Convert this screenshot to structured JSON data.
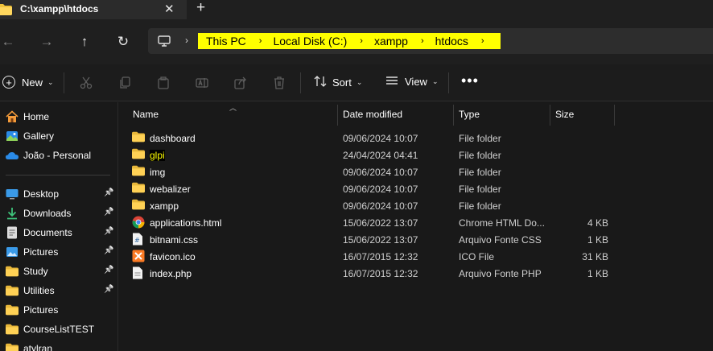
{
  "tab": {
    "title": "C:\\xampp\\htdocs",
    "close": "✕",
    "new_tab": "+"
  },
  "nav": {
    "back": "←",
    "forward": "→",
    "up": "↑",
    "refresh": "↻"
  },
  "address": {
    "crumbs": [
      "This PC",
      "Local Disk (C:)",
      "xampp",
      "htdocs"
    ],
    "highlight_color": "#ffff00"
  },
  "commands": {
    "new": "New",
    "sort": "Sort",
    "view": "View",
    "more": "•••"
  },
  "sidebar": {
    "quick": [
      {
        "label": "Home",
        "icon": "home-icon"
      },
      {
        "label": "Gallery",
        "icon": "gallery-icon"
      },
      {
        "label": "João - Personal",
        "icon": "onedrive-icon"
      }
    ],
    "pinned": [
      {
        "label": "Desktop",
        "icon": "desktop-icon",
        "pinned": true
      },
      {
        "label": "Downloads",
        "icon": "downloads-icon",
        "pinned": true
      },
      {
        "label": "Documents",
        "icon": "documents-icon",
        "pinned": true
      },
      {
        "label": "Pictures",
        "icon": "pictures-icon",
        "pinned": true
      },
      {
        "label": "Study",
        "icon": "folder-icon",
        "pinned": true
      },
      {
        "label": "Utilities",
        "icon": "folder-icon",
        "pinned": true
      },
      {
        "label": "Pictures",
        "icon": "folder-icon",
        "pinned": false
      },
      {
        "label": "CourseListTEST",
        "icon": "folder-icon",
        "pinned": false
      },
      {
        "label": "atylran",
        "icon": "folder-icon",
        "pinned": false
      }
    ]
  },
  "columns": {
    "name": "Name",
    "date": "Date modified",
    "type": "Type",
    "size": "Size"
  },
  "files": [
    {
      "name": "dashboard",
      "date": "09/06/2024 10:07",
      "type": "File folder",
      "size": "",
      "icon": "folder-icon",
      "highlight": false
    },
    {
      "name": "glpi",
      "date": "24/04/2024 04:41",
      "type": "File folder",
      "size": "",
      "icon": "folder-icon",
      "highlight": true
    },
    {
      "name": "img",
      "date": "09/06/2024 10:07",
      "type": "File folder",
      "size": "",
      "icon": "folder-icon",
      "highlight": false
    },
    {
      "name": "webalizer",
      "date": "09/06/2024 10:07",
      "type": "File folder",
      "size": "",
      "icon": "folder-icon",
      "highlight": false
    },
    {
      "name": "xampp",
      "date": "09/06/2024 10:07",
      "type": "File folder",
      "size": "",
      "icon": "folder-icon",
      "highlight": false
    },
    {
      "name": "applications.html",
      "date": "15/06/2022 13:07",
      "type": "Chrome HTML Do...",
      "size": "4 KB",
      "icon": "chrome-icon",
      "highlight": false
    },
    {
      "name": "bitnami.css",
      "date": "15/06/2022 13:07",
      "type": "Arquivo Fonte CSS",
      "size": "1 KB",
      "icon": "css-file-icon",
      "highlight": false
    },
    {
      "name": "favicon.ico",
      "date": "16/07/2015 12:32",
      "type": "ICO File",
      "size": "31 KB",
      "icon": "xampp-icon",
      "highlight": false
    },
    {
      "name": "index.php",
      "date": "16/07/2015 12:32",
      "type": "Arquivo Fonte PHP",
      "size": "1 KB",
      "icon": "php-file-icon",
      "highlight": false
    }
  ]
}
